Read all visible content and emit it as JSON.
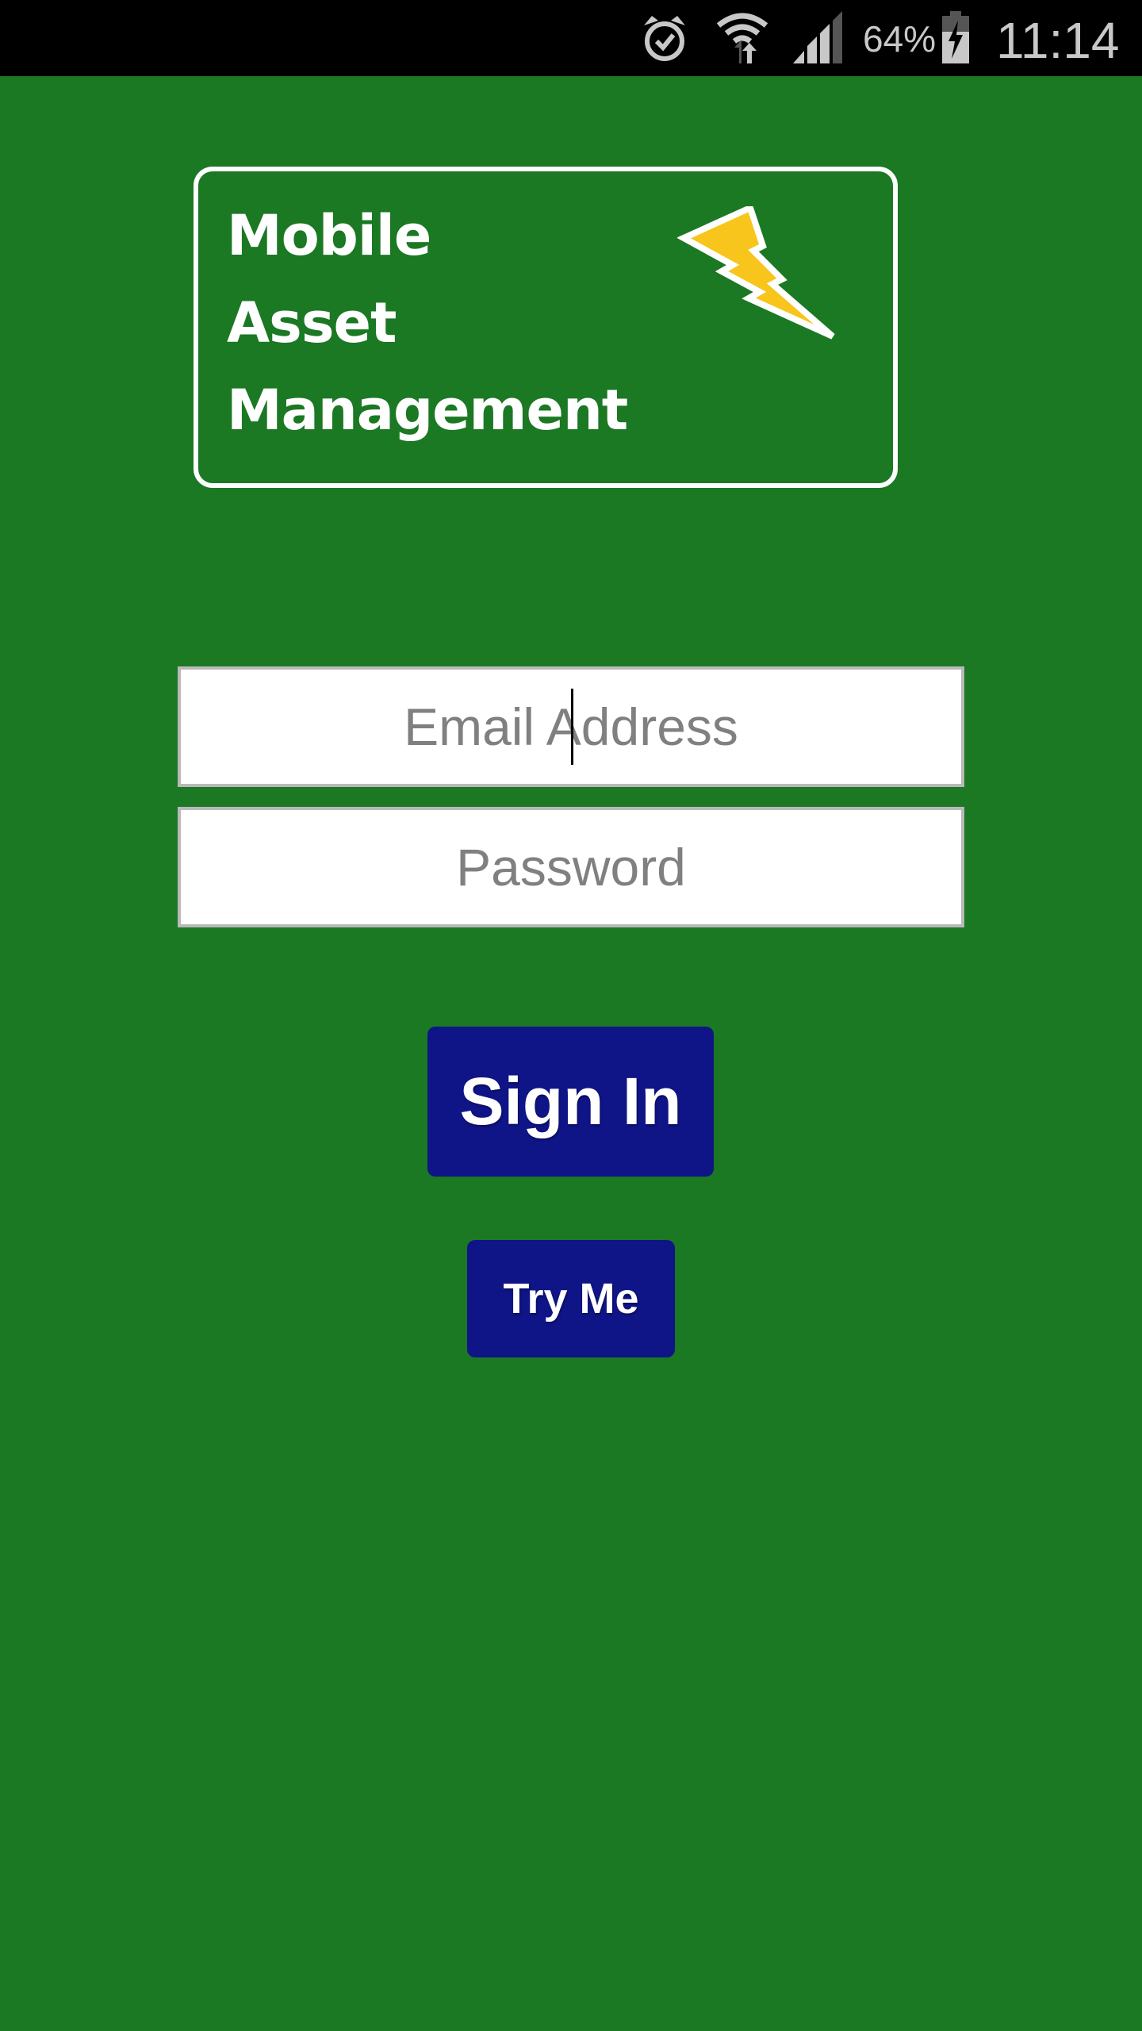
{
  "status_bar": {
    "battery_percent": "64%",
    "time": "11:14",
    "icons": [
      "alarm-icon",
      "wifi-icon",
      "signal-icon",
      "battery-charging-icon"
    ]
  },
  "logo": {
    "lines": [
      "Mobile",
      "Asset",
      "Management"
    ],
    "icon": "lightning-bolt-icon"
  },
  "form": {
    "email": {
      "placeholder": "Email Address",
      "value": ""
    },
    "password": {
      "placeholder": "Password",
      "value": ""
    }
  },
  "buttons": {
    "sign_in": "Sign In",
    "try_me": "Try Me"
  },
  "colors": {
    "background": "#1b7823",
    "button": "#0f1487",
    "bolt": "#f7c51c"
  }
}
